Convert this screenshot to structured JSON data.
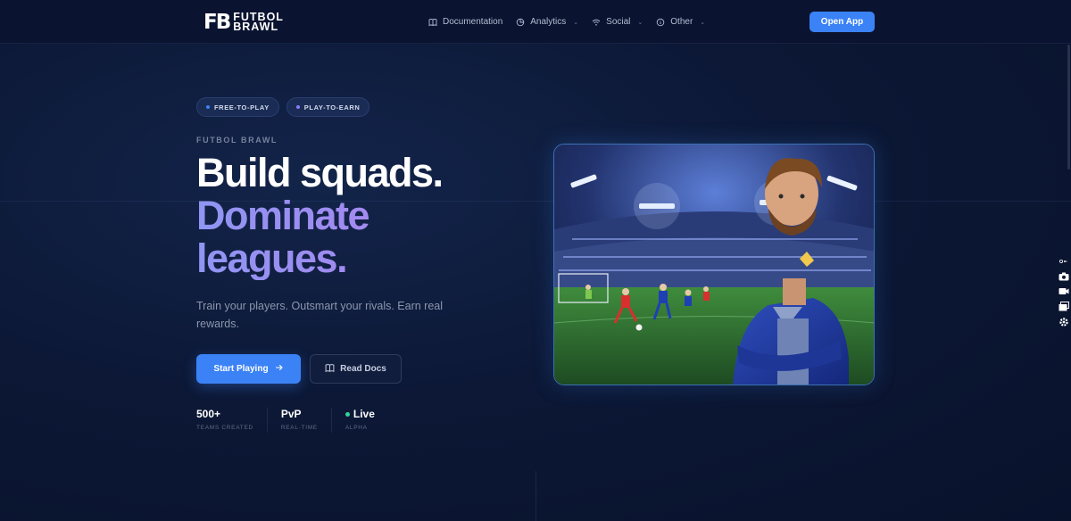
{
  "nav": {
    "logo_mark": "FB",
    "logo_line1": "FUTBOL",
    "logo_line2": "BRAWL",
    "links": [
      {
        "label": "Documentation",
        "icon": "book-icon",
        "has_dropdown": false
      },
      {
        "label": "Analytics",
        "icon": "pie-chart-icon",
        "has_dropdown": true
      },
      {
        "label": "Social",
        "icon": "wifi-icon",
        "has_dropdown": true
      },
      {
        "label": "Other",
        "icon": "info-icon",
        "has_dropdown": true
      }
    ],
    "cta_label": "Open App"
  },
  "hero": {
    "badges": [
      {
        "label": "FREE-TO-PLAY",
        "dot_color": "#3b82f6"
      },
      {
        "label": "PLAY-TO-EARN",
        "dot_color": "#8b7cf6"
      }
    ],
    "eyebrow": "FUTBOL BRAWL",
    "headline_line1": "Build squads.",
    "headline_line2": "Dominate",
    "headline_line3": "leagues.",
    "subtitle": "Train your players. Outsmart your rivals. Earn real rewards.",
    "primary_button": "Start Playing",
    "secondary_button": "Read Docs",
    "stats": [
      {
        "value": "500+",
        "label": "TEAMS CREATED",
        "live_dot": false
      },
      {
        "value": "PvP",
        "label": "REAL-TIME",
        "live_dot": false
      },
      {
        "value": "Live",
        "label": "ALPHA",
        "live_dot": true
      }
    ]
  },
  "colors": {
    "accent": "#3b82f6",
    "background": "#0c1836",
    "headline_gradient": "#a08bf0",
    "live_dot": "#34d399"
  }
}
